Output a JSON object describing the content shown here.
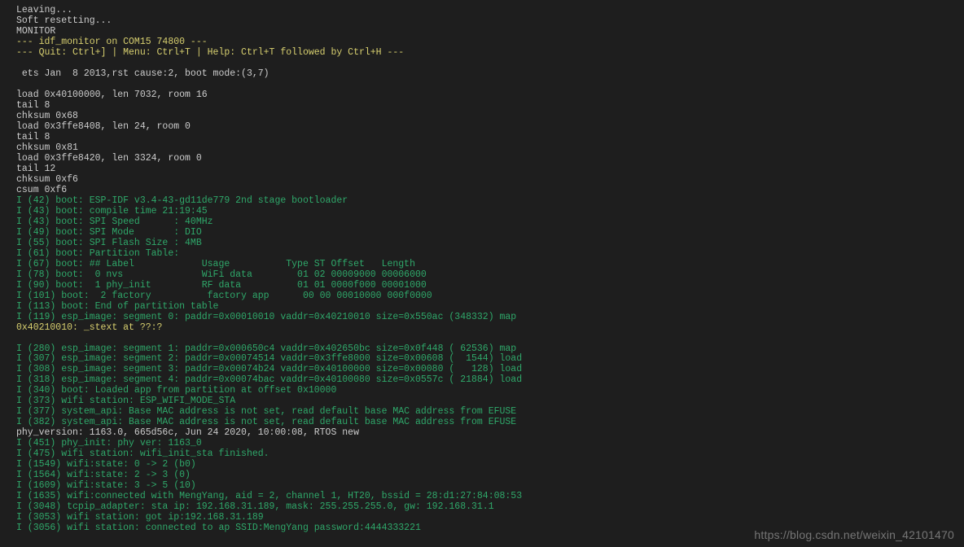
{
  "lines": [
    {
      "cls": "c-white",
      "text": "Leaving..."
    },
    {
      "cls": "c-white",
      "text": "Soft resetting..."
    },
    {
      "cls": "c-white",
      "text": "MONITOR"
    },
    {
      "cls": "c-yellow",
      "text": "--- idf_monitor on COM15 74800 ---"
    },
    {
      "cls": "c-yellow",
      "text": "--- Quit: Ctrl+] | Menu: Ctrl+T | Help: Ctrl+T followed by Ctrl+H ---"
    },
    {
      "cls": "c-white",
      "text": ""
    },
    {
      "cls": "c-white",
      "text": " ets Jan  8 2013,rst cause:2, boot mode:(3,7)"
    },
    {
      "cls": "c-white",
      "text": ""
    },
    {
      "cls": "c-white",
      "text": "load 0x40100000, len 7032, room 16"
    },
    {
      "cls": "c-white",
      "text": "tail 8"
    },
    {
      "cls": "c-white",
      "text": "chksum 0x68"
    },
    {
      "cls": "c-white",
      "text": "load 0x3ffe8408, len 24, room 0"
    },
    {
      "cls": "c-white",
      "text": "tail 8"
    },
    {
      "cls": "c-white",
      "text": "chksum 0x81"
    },
    {
      "cls": "c-white",
      "text": "load 0x3ffe8420, len 3324, room 0"
    },
    {
      "cls": "c-white",
      "text": "tail 12"
    },
    {
      "cls": "c-white",
      "text": "chksum 0xf6"
    },
    {
      "cls": "c-white",
      "text": "csum 0xf6"
    },
    {
      "cls": "c-green",
      "text": "I (42) boot: ESP-IDF v3.4-43-gd11de779 2nd stage bootloader"
    },
    {
      "cls": "c-green",
      "text": "I (43) boot: compile time 21:19:45"
    },
    {
      "cls": "c-green",
      "text": "I (43) boot: SPI Speed      : 40MHz"
    },
    {
      "cls": "c-green",
      "text": "I (49) boot: SPI Mode       : DIO"
    },
    {
      "cls": "c-green",
      "text": "I (55) boot: SPI Flash Size : 4MB"
    },
    {
      "cls": "c-green",
      "text": "I (61) boot: Partition Table:"
    },
    {
      "cls": "c-green",
      "text": "I (67) boot: ## Label            Usage          Type ST Offset   Length"
    },
    {
      "cls": "c-green",
      "text": "I (78) boot:  0 nvs              WiFi data        01 02 00009000 00006000"
    },
    {
      "cls": "c-green",
      "text": "I (90) boot:  1 phy_init         RF data          01 01 0000f000 00001000"
    },
    {
      "cls": "c-green",
      "text": "I (101) boot:  2 factory          factory app      00 00 00010000 000f0000"
    },
    {
      "cls": "c-green",
      "text": "I (113) boot: End of partition table"
    },
    {
      "cls": "c-green",
      "text": "I (119) esp_image: segment 0: paddr=0x00010010 vaddr=0x40210010 size=0x550ac (348332) map"
    },
    {
      "cls": "c-yellow",
      "text": "0x40210010: _stext at ??:?"
    },
    {
      "cls": "c-white",
      "text": ""
    },
    {
      "cls": "c-green",
      "text": "I (280) esp_image: segment 1: paddr=0x000650c4 vaddr=0x402650bc size=0x0f448 ( 62536) map"
    },
    {
      "cls": "c-green",
      "text": "I (307) esp_image: segment 2: paddr=0x00074514 vaddr=0x3ffe8000 size=0x00608 (  1544) load"
    },
    {
      "cls": "c-green",
      "text": "I (308) esp_image: segment 3: paddr=0x00074b24 vaddr=0x40100000 size=0x00080 (   128) load"
    },
    {
      "cls": "c-green",
      "text": "I (318) esp_image: segment 4: paddr=0x00074bac vaddr=0x40100080 size=0x0557c ( 21884) load"
    },
    {
      "cls": "c-green",
      "text": "I (340) boot: Loaded app from partition at offset 0x10000"
    },
    {
      "cls": "c-green",
      "text": "I (373) wifi station: ESP_WIFI_MODE_STA"
    },
    {
      "cls": "c-green",
      "text": "I (377) system_api: Base MAC address is not set, read default base MAC address from EFUSE"
    },
    {
      "cls": "c-green",
      "text": "I (382) system_api: Base MAC address is not set, read default base MAC address from EFUSE"
    },
    {
      "cls": "c-white",
      "text": "phy_version: 1163.0, 665d56c, Jun 24 2020, 10:00:08, RTOS new"
    },
    {
      "cls": "c-green",
      "text": "I (451) phy_init: phy ver: 1163_0"
    },
    {
      "cls": "c-green",
      "text": "I (475) wifi station: wifi_init_sta finished."
    },
    {
      "cls": "c-green",
      "text": "I (1549) wifi:state: 0 -> 2 (b0)"
    },
    {
      "cls": "c-green",
      "text": "I (1564) wifi:state: 2 -> 3 (0)"
    },
    {
      "cls": "c-green",
      "text": "I (1609) wifi:state: 3 -> 5 (10)"
    },
    {
      "cls": "c-green",
      "text": "I (1635) wifi:connected with MengYang, aid = 2, channel 1, HT20, bssid = 28:d1:27:84:08:53"
    },
    {
      "cls": "c-green",
      "text": "I (3048) tcpip_adapter: sta ip: 192.168.31.189, mask: 255.255.255.0, gw: 192.168.31.1"
    },
    {
      "cls": "c-green",
      "text": "I (3053) wifi station: got ip:192.168.31.189"
    },
    {
      "cls": "c-green",
      "text": "I (3056) wifi station: connected to ap SSID:MengYang password:4444333221"
    }
  ],
  "watermark": "https://blog.csdn.net/weixin_42101470"
}
